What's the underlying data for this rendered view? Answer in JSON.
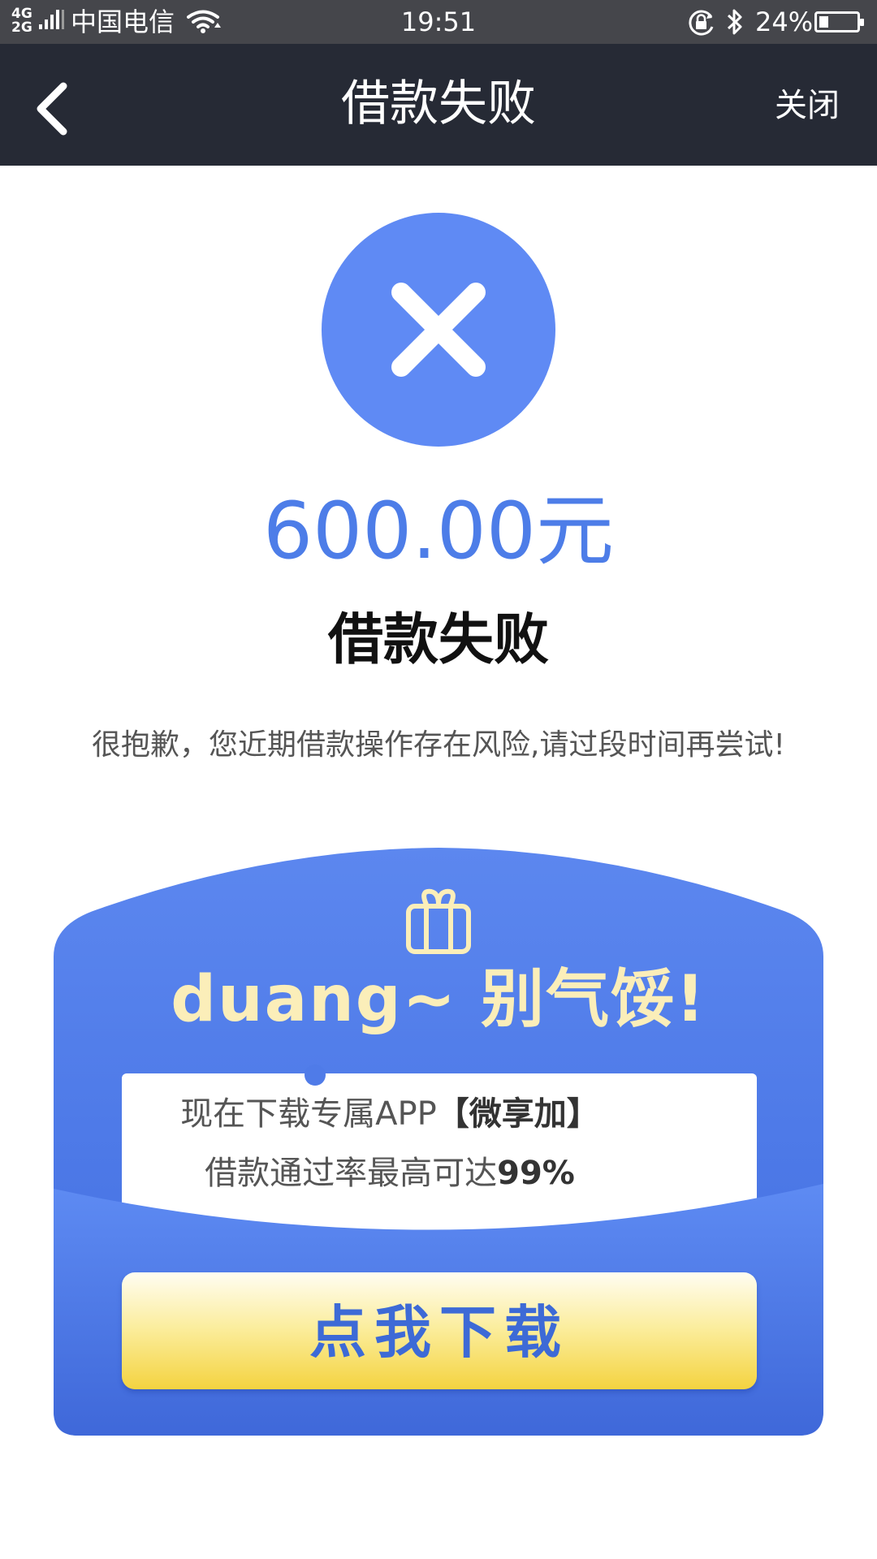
{
  "status_bar": {
    "network": "4G 2G",
    "carrier": "中国电信",
    "time": "19:51",
    "battery": "24%",
    "battery_level": 0.24
  },
  "nav": {
    "title": "借款失败",
    "close_label": "关闭"
  },
  "result": {
    "amount": "600.00元",
    "title": "借款失败",
    "description": "很抱歉，您近期借款操作存在风险,请过段时间再尝试!"
  },
  "promo": {
    "headline": "duang~ 别气馁!",
    "line1_prefix": "现在下载专属APP",
    "line1_app": "【微享加】",
    "line2_prefix": "借款通过率最高可达",
    "line2_rate": "99%",
    "button_label": "点我下载"
  },
  "colors": {
    "status_bar_bg": "#45464b",
    "nav_bg": "#262a35",
    "accent_blue": "#5f8af4",
    "amount_blue": "#4d7de8",
    "button_yellow": "#f4d340",
    "headline_cream": "#fbeeb9"
  },
  "icons": {
    "back": "chevron-left-icon",
    "fail": "close-icon",
    "gift": "gift-icon",
    "wifi": "wifi-icon",
    "bluetooth": "bluetooth-icon",
    "rotation_lock": "rotation-lock-icon",
    "battery": "battery-icon"
  }
}
